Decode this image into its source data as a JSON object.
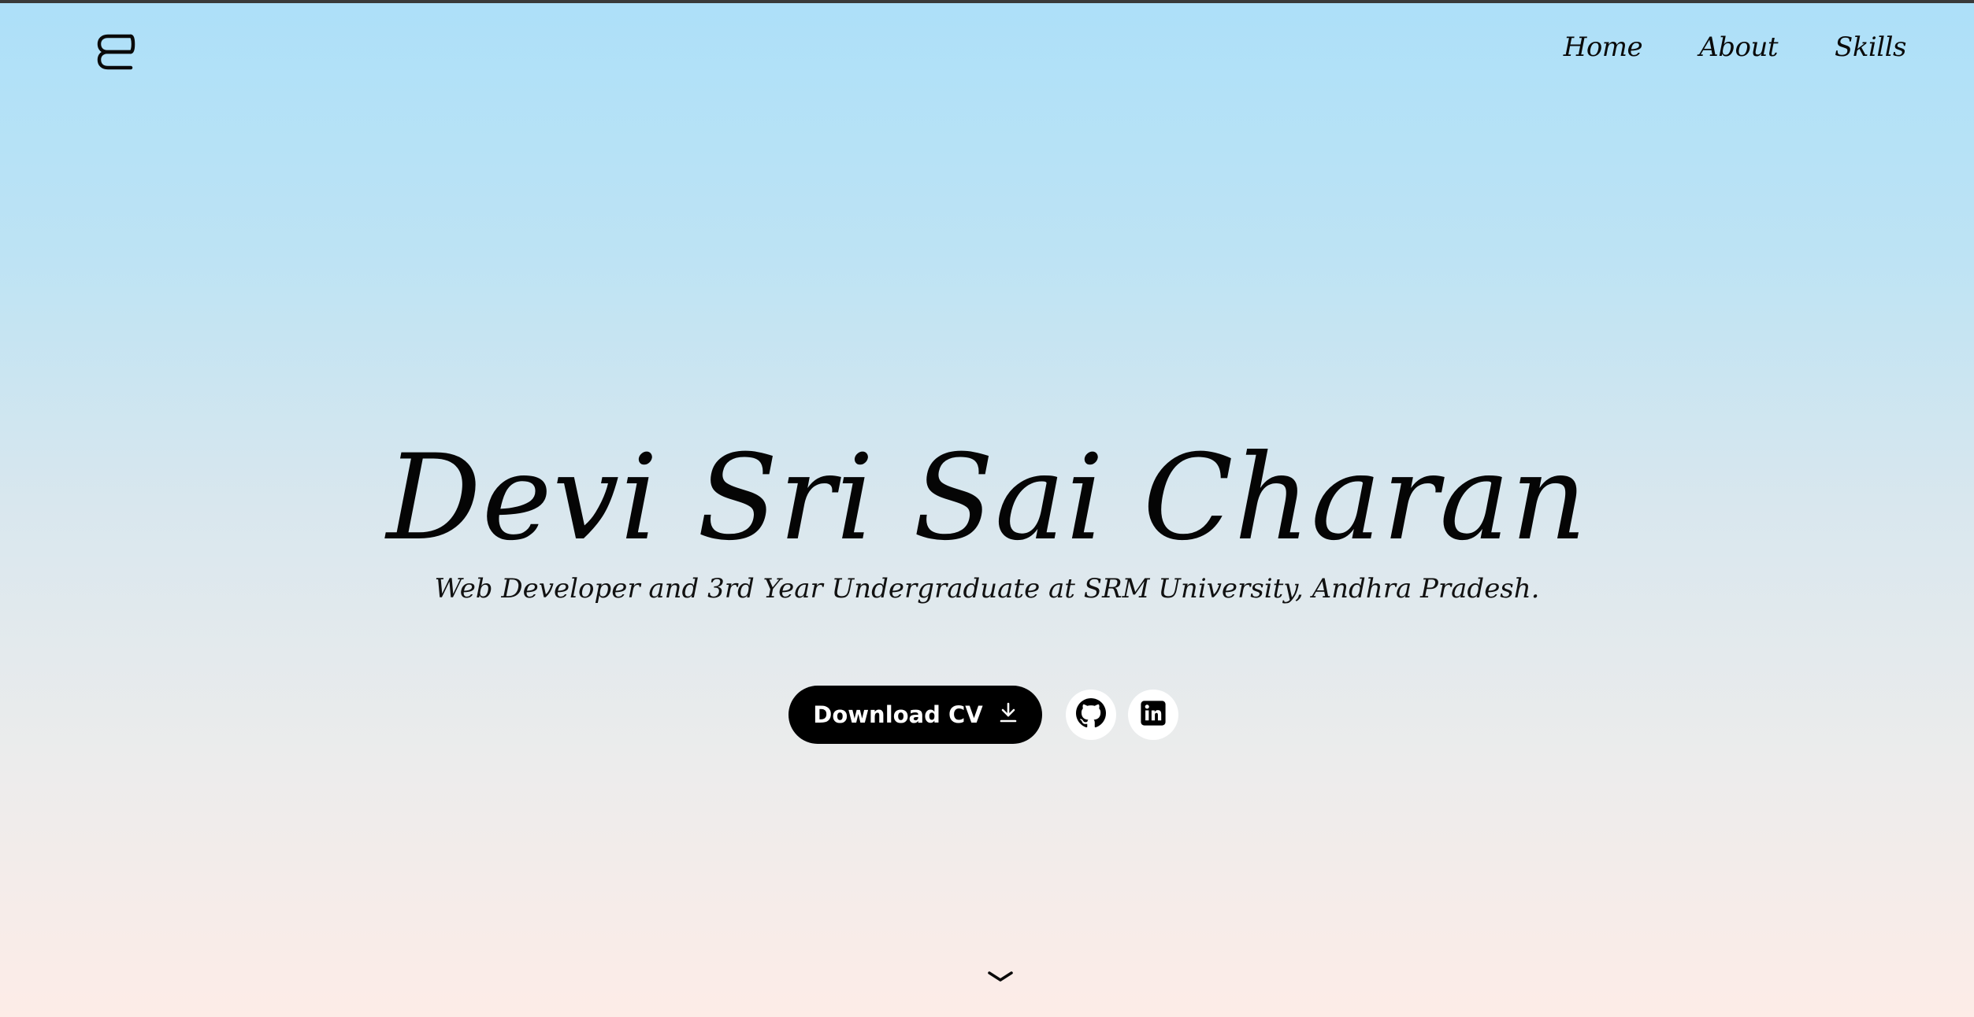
{
  "header": {
    "logo_icon": "wave-logo-icon",
    "nav": [
      {
        "label": "Home"
      },
      {
        "label": "About"
      },
      {
        "label": "Skills"
      }
    ]
  },
  "hero": {
    "title": "Devi Sri Sai Charan",
    "subtitle": "Web Developer and 3rd Year Undergraduate at SRM University, Andhra Pradesh.",
    "download_label": "Download CV",
    "download_icon": "download-icon",
    "socials": [
      {
        "icon": "github-icon"
      },
      {
        "icon": "linkedin-icon"
      }
    ],
    "scroll_icon": "chevron-down-icon"
  },
  "colors": {
    "gradient_top": "#ade0f9",
    "gradient_bottom": "#fdece7",
    "button_bg": "#000000",
    "text": "#050505"
  }
}
